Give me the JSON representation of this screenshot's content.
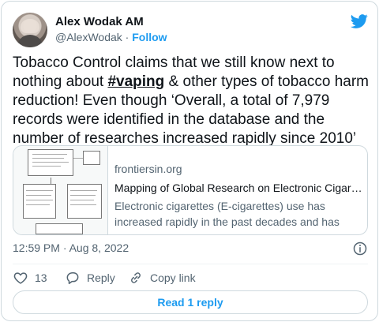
{
  "author": {
    "name": "Alex Wodak AM",
    "handle": "@AlexWodak",
    "separator": "·",
    "follow_label": "Follow"
  },
  "tweet": {
    "text_before": "Tobacco Control claims that we still know next to nothing about ",
    "hashtag": "#vaping",
    "text_after": " & other types of tobacco harm reduction! Even though ‘Overall, a total of 7,979 records were identified in the database and the number of researches increased rapidly since 2010’"
  },
  "link_card": {
    "domain": "frontiersin.org",
    "title": "Mapping of Global Research on Electronic Cigarettes...",
    "description": "Electronic cigarettes (E-cigarettes) use has increased rapidly in the past decades and has been widely ..."
  },
  "timestamp": "12:59 PM · Aug 8, 2022",
  "actions": {
    "like_count": "13",
    "reply_label": "Reply",
    "copy_link_label": "Copy link"
  },
  "read_replies_label": "Read 1 reply",
  "icons": {
    "brand": "twitter-bird-icon",
    "info": "info-icon",
    "like": "heart-icon",
    "reply": "reply-bubble-icon",
    "copy_link": "link-icon"
  },
  "colors": {
    "accent": "#1d9bf0",
    "text": "#0f1419",
    "secondary": "#536471",
    "border": "#cfd9de"
  }
}
